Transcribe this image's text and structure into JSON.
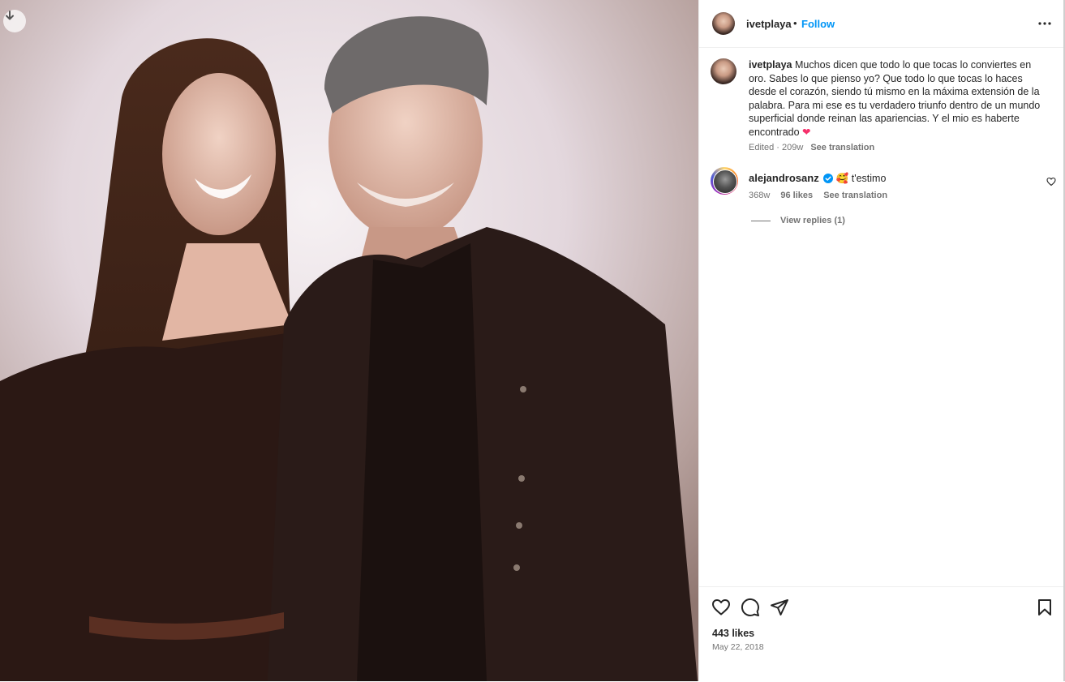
{
  "post": {
    "author": "ivetplaya",
    "separator": "•",
    "follow_label": "Follow",
    "more_icon": "more-options-icon",
    "download_icon": "download-icon"
  },
  "caption": {
    "username": "ivetplaya",
    "text": "Muchos dicen que todo lo que tocas lo conviertes en oro. Sabes lo que pienso yo? Que todo lo que tocas lo haces desde el corazón, siendo tú mismo en la máxima extensión de la palabra. Para mi ese es tu verdadero triunfo dentro de un mundo superficial donde reinan las apariencias. Y el mio es haberte encontrado",
    "emoji": "❤",
    "meta": "Edited · 209w",
    "see_translation": "See translation"
  },
  "comment": {
    "username": "alejandrosanz",
    "emoji": "🥰",
    "text": "t'estimo",
    "age": "368w",
    "likes": "96 likes",
    "see_translation": "See translation",
    "view_replies": "View replies (1)"
  },
  "footer": {
    "likes": "443 likes",
    "date": "May 22, 2018"
  },
  "colors": {
    "accent": "#0095f6",
    "text": "#262626",
    "secondary": "#737373",
    "heart": "#f5306b"
  }
}
